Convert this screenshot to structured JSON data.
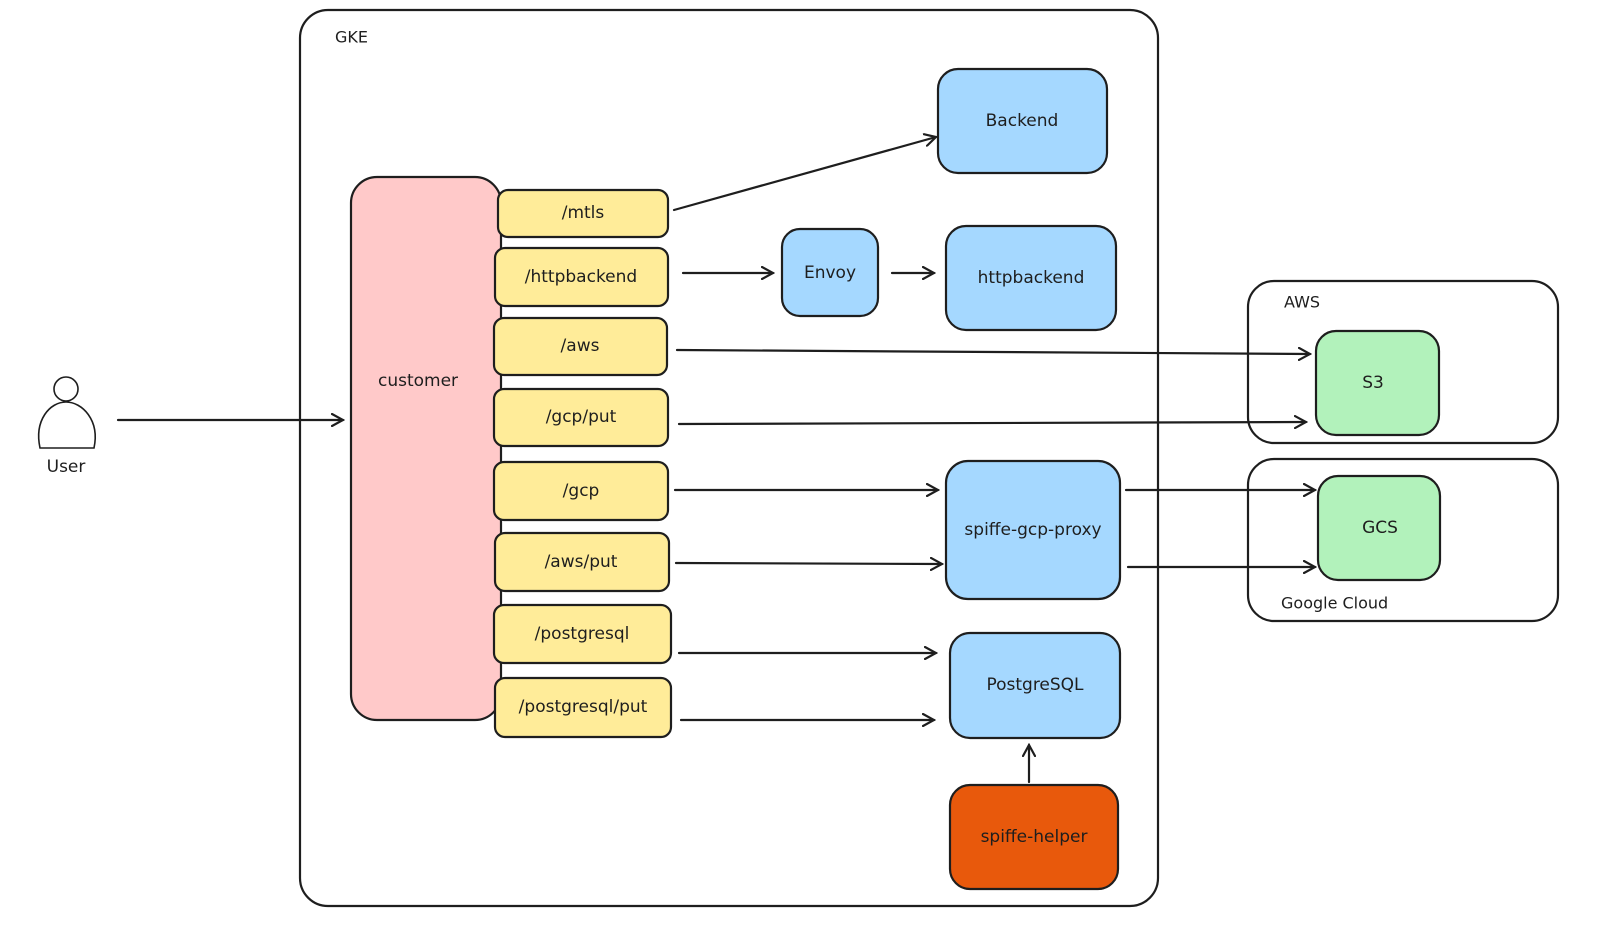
{
  "colors": {
    "route": "#ffec99",
    "service": "#a5d8ff",
    "customer": "#ffc9c9",
    "storage": "#b2f2bb",
    "helper": "#e8590c",
    "stroke": "#1e1e1e"
  },
  "user": {
    "label": "User",
    "icon": "person-icon"
  },
  "groups": {
    "gke": "GKE",
    "aws": "AWS",
    "gcp": "Google Cloud"
  },
  "customer": "customer",
  "routes": [
    "/mtls",
    "/httpbackend",
    "/aws",
    "/gcp/put",
    "/gcp",
    "/aws/put",
    "/postgresql",
    "/postgresql/put"
  ],
  "services": {
    "backend": "Backend",
    "envoy": "Envoy",
    "httpbackend": "httpbackend",
    "proxy": "spiffe-gcp-proxy",
    "postgres": "PostgreSQL",
    "helper": "spiffe-helper",
    "s3": "S3",
    "gcs": "GCS"
  },
  "edges": [
    [
      "User",
      "customer"
    ],
    [
      "/mtls",
      "Backend"
    ],
    [
      "/httpbackend",
      "Envoy"
    ],
    [
      "Envoy",
      "httpbackend"
    ],
    [
      "/aws",
      "S3"
    ],
    [
      "/gcp/put",
      "S3"
    ],
    [
      "/gcp",
      "spiffe-gcp-proxy"
    ],
    [
      "/aws/put",
      "spiffe-gcp-proxy"
    ],
    [
      "/postgresql",
      "PostgreSQL"
    ],
    [
      "/postgresql/put",
      "PostgreSQL"
    ],
    [
      "spiffe-helper",
      "PostgreSQL"
    ],
    [
      "spiffe-gcp-proxy",
      "GCS"
    ],
    [
      "spiffe-gcp-proxy",
      "GCS"
    ]
  ]
}
